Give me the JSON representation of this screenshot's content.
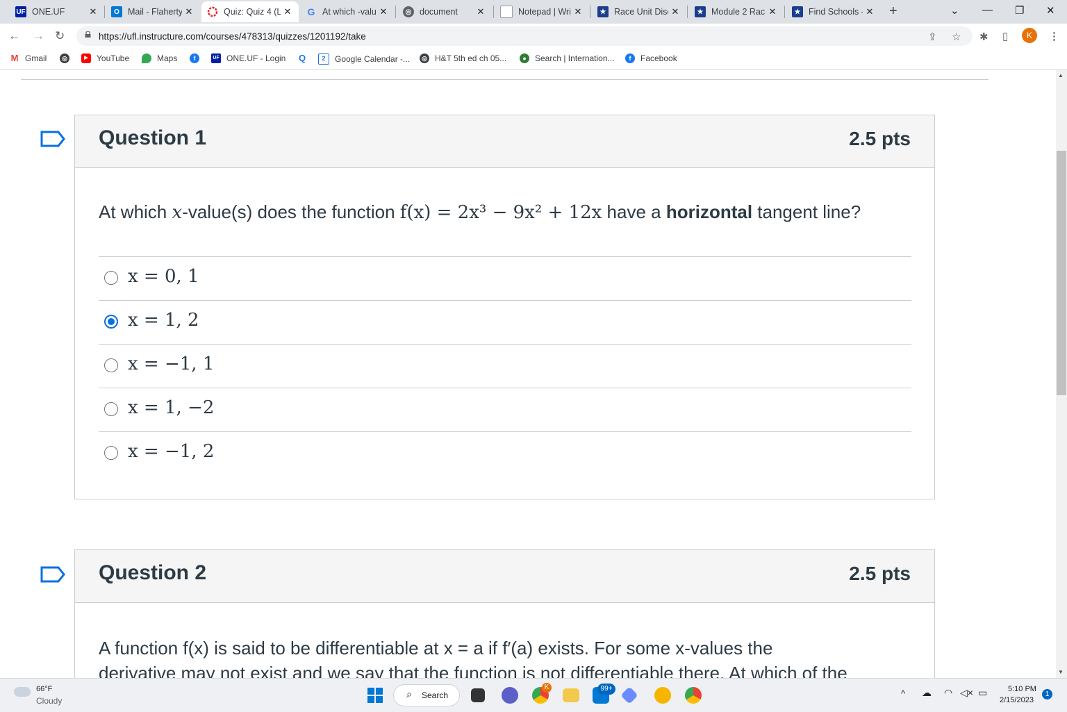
{
  "browser": {
    "tabs": [
      {
        "title": "ONE.UF",
        "favicon": "uf-logo-icon",
        "active": false
      },
      {
        "title": "Mail - Flaherty",
        "favicon": "outlook-icon",
        "active": false
      },
      {
        "title": "Quiz: Quiz 4 (L",
        "favicon": "canvas-icon",
        "active": true
      },
      {
        "title": "At which -valu",
        "favicon": "google-icon",
        "active": false
      },
      {
        "title": "document",
        "favicon": "globe-icon",
        "active": false
      },
      {
        "title": "Notepad | Wri",
        "favicon": "notepad-icon",
        "active": false
      },
      {
        "title": "Race Unit Disc",
        "favicon": "star-icon",
        "active": false
      },
      {
        "title": "Module 2 Rac",
        "favicon": "star-icon",
        "active": false
      },
      {
        "title": "Find Schools -",
        "favicon": "star-icon",
        "active": false
      }
    ],
    "url": "https://ufl.instructure.com/courses/478313/quizzes/1201192/take",
    "profile_initial": "K",
    "bookmarks": [
      "Gmail",
      "",
      "YouTube",
      "Maps",
      "",
      "ONE.UF - Login",
      "",
      "Google Calendar -...",
      "H&T 5th ed ch 05...",
      "Search | Internation...",
      "Facebook"
    ],
    "calendar_day": "2",
    "accent": "#1a73e8"
  },
  "quiz": {
    "questions": [
      {
        "name": "Question 1",
        "points": "2.5 pts",
        "text_prefix": "At which ",
        "text_var": "x",
        "text_mid": "-value(s) does the function ",
        "text_func": "f(x) = 2x³ − 9x² + 12x",
        "text_pre_bold": " have a ",
        "text_bold": "horizontal",
        "text_suffix": " tangent line?",
        "answers": [
          {
            "label": "x = 0, 1",
            "selected": false
          },
          {
            "label": "x = 1, 2",
            "selected": true
          },
          {
            "label": "x = −1, 1",
            "selected": false
          },
          {
            "label": "x = 1, −2",
            "selected": false
          },
          {
            "label": "x = −1, 2",
            "selected": false
          }
        ]
      },
      {
        "name": "Question 2",
        "points": "2.5 pts",
        "text_line1": "A function f(x) is said to be differentiable at x = a if f′(a) exists.  For some x-values the",
        "text_line2": "derivative may not exist and we say that the function is not differentiable there.  At which of the"
      }
    ],
    "selected_color": "#0770e3"
  },
  "taskbar": {
    "weather_temp": "66°F",
    "weather_desc": "Cloudy",
    "search_label": "Search",
    "mail_badge": "99+",
    "time": "5:10 PM",
    "date": "2/15/2023",
    "notification_count": "1"
  }
}
